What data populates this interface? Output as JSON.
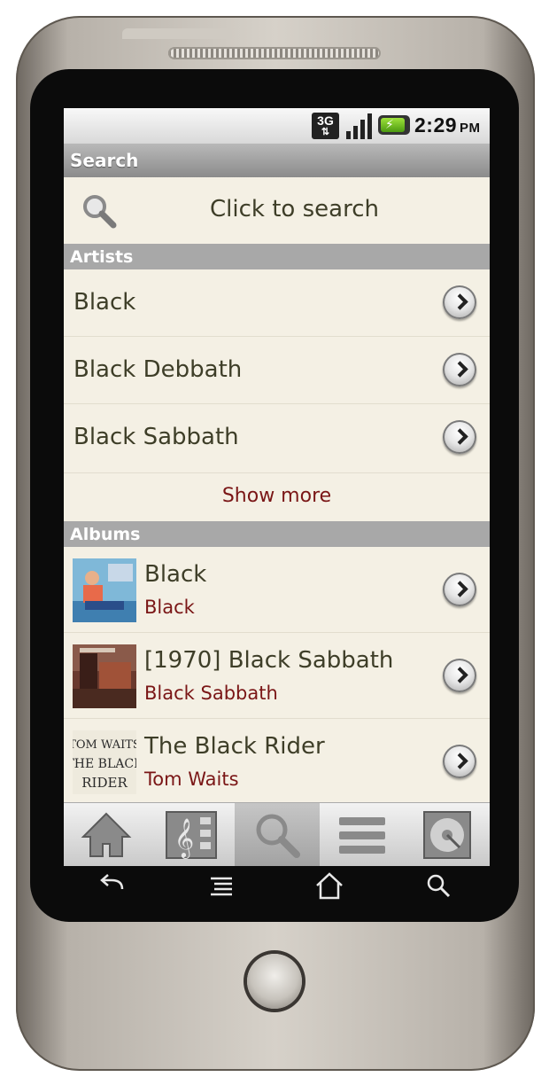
{
  "status": {
    "network": "3G",
    "time": "2:29",
    "ampm": "PM"
  },
  "titlebar": {
    "title": "Search"
  },
  "search": {
    "placeholder": "Click to search"
  },
  "artists": {
    "header": "Artists",
    "items": [
      {
        "name": "Black"
      },
      {
        "name": "Black Debbath"
      },
      {
        "name": "Black Sabbath"
      }
    ],
    "show_more": "Show more"
  },
  "albums": {
    "header": "Albums",
    "items": [
      {
        "title": "Black",
        "artist": "Black"
      },
      {
        "title": "[1970] Black Sabbath",
        "artist": "Black Sabbath"
      },
      {
        "title": "The Black Rider",
        "artist": "Tom Waits"
      }
    ]
  },
  "album_cover_text": {
    "tom_waits": "TOM WAITS",
    "the_black": "THE BLACK",
    "rider": "RIDER"
  },
  "tabs": [
    {
      "icon": "home-icon"
    },
    {
      "icon": "music-library-icon"
    },
    {
      "icon": "search-icon",
      "active": true
    },
    {
      "icon": "playlists-icon"
    },
    {
      "icon": "now-playing-icon"
    }
  ],
  "softkeys": [
    "back-icon",
    "menu-icon",
    "home-icon",
    "search-icon"
  ],
  "colors": {
    "list_bg": "#f4f0e4",
    "section_header": "#a8a8a8",
    "artist_text": "#7a1616",
    "primary_text": "#3e3e28"
  }
}
